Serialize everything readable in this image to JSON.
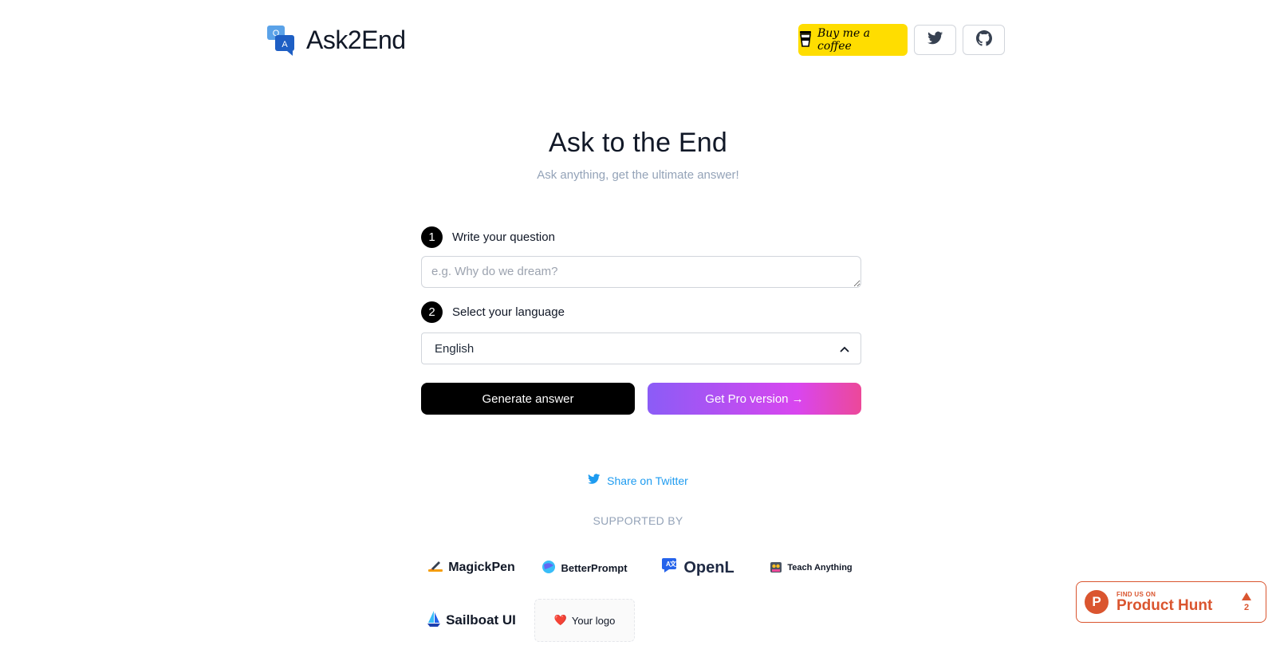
{
  "brand": {
    "name": "Ask2End",
    "logo_icon": "qa-chat-icon"
  },
  "header": {
    "coffee_label": "Buy me a coffee",
    "twitter_icon": "twitter-icon",
    "github_icon": "github-icon"
  },
  "hero": {
    "title": "Ask to the End",
    "subtitle": "Ask anything, get the ultimate answer!"
  },
  "form": {
    "step1": {
      "number": "1",
      "label": "Write your question"
    },
    "question_placeholder": "e.g. Why do we dream?",
    "question_value": "",
    "step2": {
      "number": "2",
      "label": "Select your language"
    },
    "language_selected": "English",
    "generate_label": "Generate answer",
    "pro_label": "Get Pro version →"
  },
  "share": {
    "label": "Share on Twitter"
  },
  "supported": {
    "heading": "SUPPORTED BY",
    "sponsors": [
      {
        "name": "MagickPen",
        "icon": "pen-icon"
      },
      {
        "name": "BetterPrompt",
        "icon": "sphere-icon"
      },
      {
        "name": "OpenL",
        "icon": "translate-icon"
      },
      {
        "name": "Teach Anything",
        "icon": "owl-icon"
      },
      {
        "name": "Sailboat UI",
        "icon": "sailboat-icon"
      },
      {
        "name": "Your logo",
        "icon": "heart-icon",
        "prefix": "❤️"
      }
    ]
  },
  "product_hunt": {
    "small": "FIND US ON",
    "big": "Product Hunt",
    "letter": "P",
    "votes": "2"
  },
  "colors": {
    "accent_blue": "#1d9bf0",
    "coffee": "#ffdd00",
    "ph_orange": "#da552f"
  }
}
